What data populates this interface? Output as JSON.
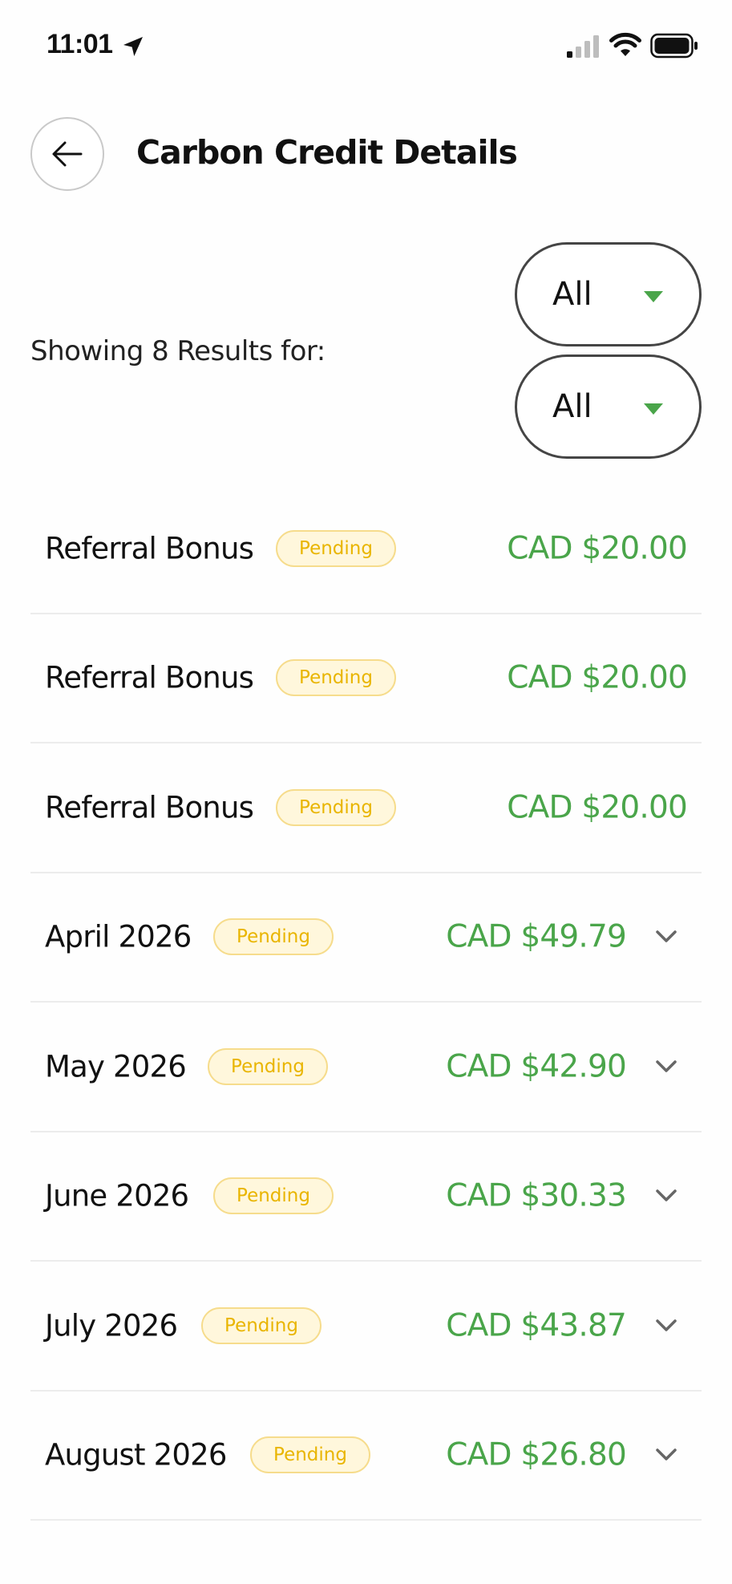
{
  "status_bar": {
    "time": "11:01",
    "icons": [
      "location-arrow-icon",
      "signal-icon",
      "wifi-icon",
      "battery-icon"
    ]
  },
  "header": {
    "title": "Carbon Credit Details",
    "back_icon": "arrow-left-icon"
  },
  "filters": {
    "results_label": "Showing 8 Results for:",
    "dropdown_1": {
      "value": "All"
    },
    "dropdown_2": {
      "value": "All"
    }
  },
  "colors": {
    "accent_green": "#4aa54a",
    "pending_text": "#e9b500",
    "pending_bg": "#fff7dc"
  },
  "items": [
    {
      "label": "Referral Bonus",
      "status": "Pending",
      "amount": "CAD $20.00",
      "expandable": false
    },
    {
      "label": "Referral Bonus",
      "status": "Pending",
      "amount": "CAD $20.00",
      "expandable": false
    },
    {
      "label": "Referral Bonus",
      "status": "Pending",
      "amount": "CAD $20.00",
      "expandable": false
    },
    {
      "label": "April 2026",
      "status": "Pending",
      "amount": "CAD $49.79",
      "expandable": true
    },
    {
      "label": "May 2026",
      "status": "Pending",
      "amount": "CAD $42.90",
      "expandable": true
    },
    {
      "label": "June 2026",
      "status": "Pending",
      "amount": "CAD $30.33",
      "expandable": true
    },
    {
      "label": "July 2026",
      "status": "Pending",
      "amount": "CAD $43.87",
      "expandable": true
    },
    {
      "label": "August 2026",
      "status": "Pending",
      "amount": "CAD $26.80",
      "expandable": true
    }
  ]
}
